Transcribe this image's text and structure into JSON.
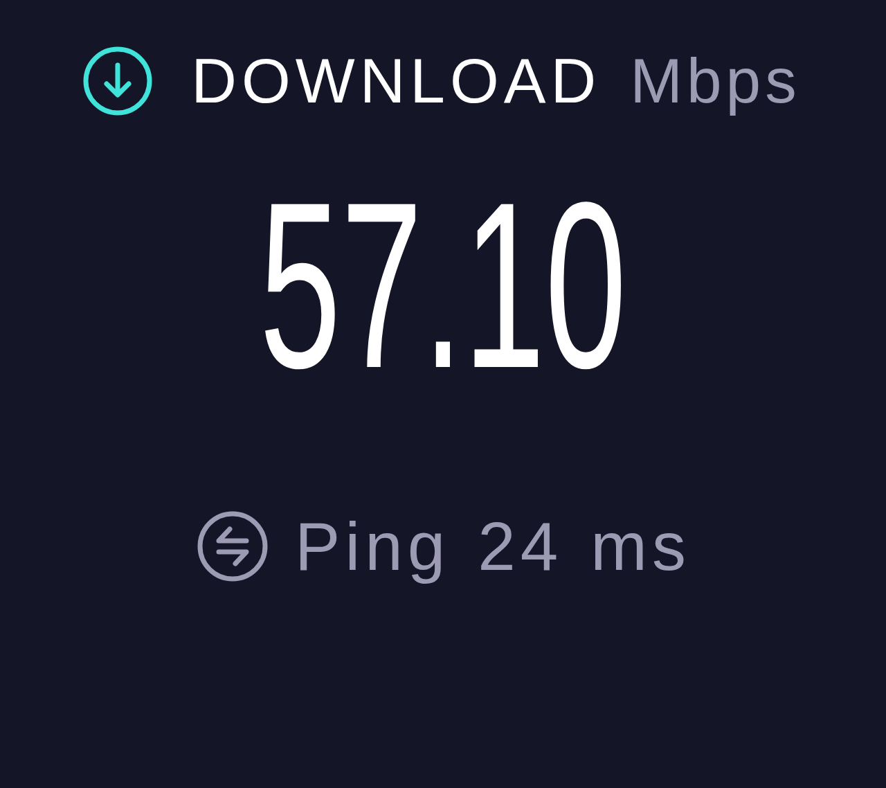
{
  "download": {
    "label": "DOWNLOAD",
    "unit": "Mbps",
    "value": "57.10"
  },
  "ping": {
    "label": "Ping",
    "value": "24",
    "unit": "ms"
  }
}
